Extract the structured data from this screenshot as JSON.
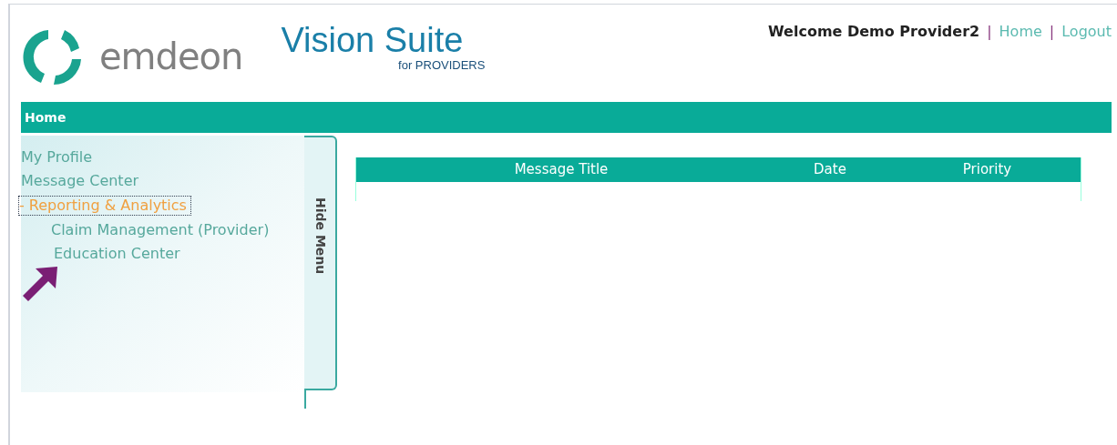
{
  "logo": {
    "brand": "emdeon",
    "product": "Vision Suite",
    "tagline": "for PROVIDERS"
  },
  "header": {
    "welcome": "Welcome Demo Provider2",
    "separator_1": "|",
    "home_link": "Home",
    "separator_2": "|",
    "logout_link": "Logout"
  },
  "nav_bar": {
    "label": "Home"
  },
  "sidebar": {
    "items": [
      {
        "label": "My Profile",
        "selected": false
      },
      {
        "label": "Message Center",
        "selected": false
      },
      {
        "label": "Reporting & Analytics",
        "toggle": "-",
        "selected": true,
        "children": [
          {
            "label": "Claim Management (Provider)",
            "selected": false
          },
          {
            "label": "Education Center",
            "selected": false
          }
        ]
      }
    ],
    "hide_tab": "Hide Menu"
  },
  "table": {
    "columns": [
      "Message Title",
      "Date",
      "Priority"
    ]
  }
}
